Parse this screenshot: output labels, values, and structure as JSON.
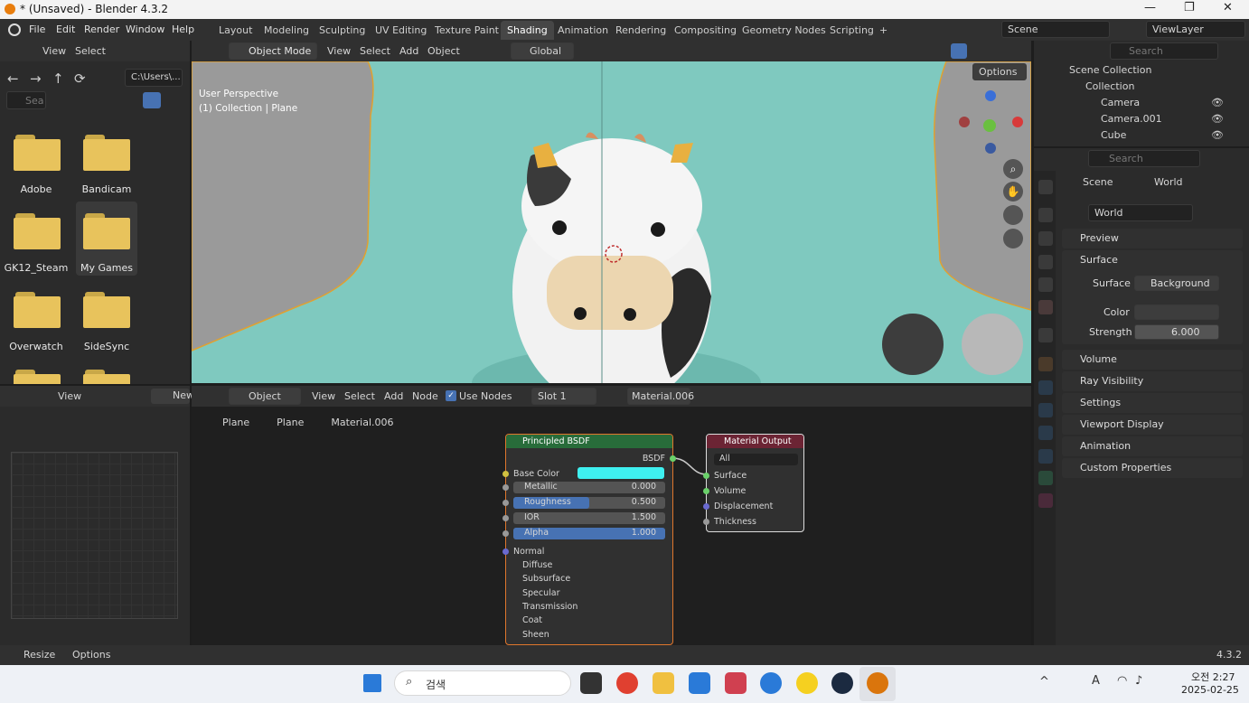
{
  "window": {
    "title": "* (Unsaved) - Blender 4.3.2",
    "min": "—",
    "max": "❐",
    "close": "✕"
  },
  "menu": [
    "File",
    "Edit",
    "Render",
    "Window",
    "Help"
  ],
  "workspaces": [
    "Layout",
    "Modeling",
    "Sculpting",
    "UV Editing",
    "Texture Paint",
    "Shading",
    "Animation",
    "Rendering",
    "Compositing",
    "Geometry Nodes",
    "Scripting",
    "+"
  ],
  "scene": {
    "name": "Scene",
    "view_layer": "ViewLayer"
  },
  "file_browser": {
    "view": "View",
    "select": "Select",
    "path": "C:\\Users\\...",
    "search_placeholder": "Sea",
    "folders": [
      "Adobe",
      "Bandicam",
      "GK12_Steam",
      "My Games",
      "Overwatch",
      "SideSync"
    ]
  },
  "viewport": {
    "mode": "Object Mode",
    "menus": [
      "View",
      "Select",
      "Add",
      "Object"
    ],
    "orientation": "Global",
    "options": "Options",
    "info1": "User Perspective",
    "info2": "(1) Collection | Plane"
  },
  "outliner": {
    "search": "Search",
    "root": "Scene Collection",
    "collection": "Collection",
    "items": [
      "Camera",
      "Camera.001",
      "Cube"
    ]
  },
  "properties": {
    "search": "Search",
    "bc_scene": "Scene",
    "bc_world": "World",
    "world_name": "World",
    "panels": [
      "Preview",
      "Surface",
      "Volume",
      "Ray Visibility",
      "Settings",
      "Viewport Display",
      "Animation",
      "Custom Properties"
    ],
    "surface_label": "Surface",
    "surface_value": "Background",
    "color_label": "Color",
    "strength_label": "Strength",
    "strength_value": "6.000"
  },
  "image_editor": {
    "view": "View",
    "new": "New"
  },
  "node_editor": {
    "object": "Object",
    "menus": [
      "View",
      "Select",
      "Add",
      "Node"
    ],
    "use_nodes": "Use Nodes",
    "slot": "Slot 1",
    "material": "Material.006",
    "breadcrumb": [
      "Plane",
      "Plane",
      "Material.006"
    ]
  },
  "bsdf": {
    "title": "Principled BSDF",
    "out": "BSDF",
    "base_color_label": "Base Color",
    "base_color": "#3ff0f0",
    "fields": [
      {
        "label": "Metallic",
        "value": "0.000",
        "fill": 0
      },
      {
        "label": "Roughness",
        "value": "0.500",
        "fill": 0.5
      },
      {
        "label": "IOR",
        "value": "1.500",
        "fill": 0
      },
      {
        "label": "Alpha",
        "value": "1.000",
        "fill": 1
      }
    ],
    "normal": "Normal",
    "sub": [
      "Diffuse",
      "Subsurface",
      "Specular",
      "Transmission",
      "Coat",
      "Sheen"
    ]
  },
  "output": {
    "title": "Material Output",
    "target": "All",
    "inputs": [
      "Surface",
      "Volume",
      "Displacement",
      "Thickness"
    ]
  },
  "status": {
    "resize": "Resize",
    "options": "Options",
    "version": "4.3.2"
  },
  "taskbar": {
    "search": "검색",
    "time": "오전 2:27",
    "date": "2025-02-25"
  }
}
